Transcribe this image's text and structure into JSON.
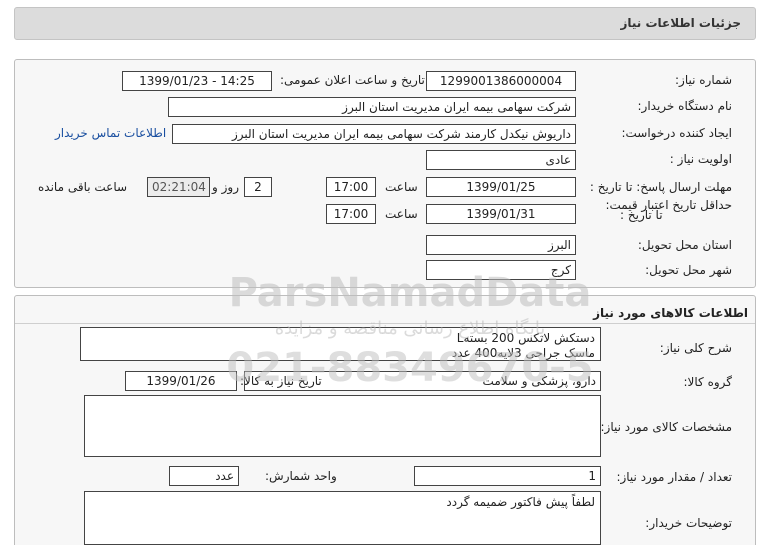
{
  "header": {
    "title": "جزئیات اطلاعات نیاز"
  },
  "fields": {
    "need_number_label": "شماره نیاز:",
    "need_number": "1299001386000004",
    "announce_label": "تاریخ و ساعت اعلان عمومی:",
    "announce_value": "1399/01/23 - 14:25",
    "buyer_org_label": "نام دستگاه خریدار:",
    "buyer_org": "شرکت سهامی بیمه ایران مدیریت استان البرز",
    "creator_label": "ایجاد کننده درخواست:",
    "creator": "داریوش  نیکدل کارمند  شرکت سهامی بیمه ایران مدیریت استان البرز",
    "contact_link": "اطلاعات تماس خریدار",
    "priority_label": "اولویت نیاز :",
    "priority": "عادی",
    "deadline_label": "مهلت ارسال پاسخ: تا تاریخ :",
    "deadline_date": "1399/01/25",
    "time_label": "ساعت",
    "deadline_time": "17:00",
    "days": "2",
    "days_label": "روز و",
    "remaining": "02:21:04",
    "remaining_label": "ساعت باقی مانده",
    "price_validity_label": "حداقل تاریخ اعتبار قیمت:",
    "to_date_label": "تا تاریخ :",
    "validity_date": "1399/01/31",
    "validity_time": "17:00",
    "province_label": "استان محل تحویل:",
    "province": "البرز",
    "city_label": "شهر محل تحویل:",
    "city": "کرج"
  },
  "goods": {
    "section_title": "اطلاعات کالاهای مورد نیاز",
    "desc_label": "شرح کلی نیاز:",
    "desc": "دستکش لاتکس 200 بستهL\nماسک جراحی 3لایه400 عدد",
    "group_label": "گروه کالا:",
    "group": "دارو، پزشکی و سلامت",
    "need_date_label": "تاریخ نیاز به کالا:",
    "need_date": "1399/01/26",
    "specs_label": "مشخصات کالای مورد نیاز:",
    "specs": "",
    "qty_label": "تعداد / مقدار مورد نیاز:",
    "qty": "1",
    "unit_label": "واحد شمارش:",
    "unit": "عدد",
    "buyer_notes_label": "توضیحات خریدار:",
    "buyer_notes": "لطفاً پیش فاکتور ضمیمه گردد"
  },
  "watermark": {
    "brand": "ParsNamadData",
    "sub": "پایگاه اطلاع رسانی مناقصه و مزایده",
    "phone": "021-88349670-5"
  }
}
